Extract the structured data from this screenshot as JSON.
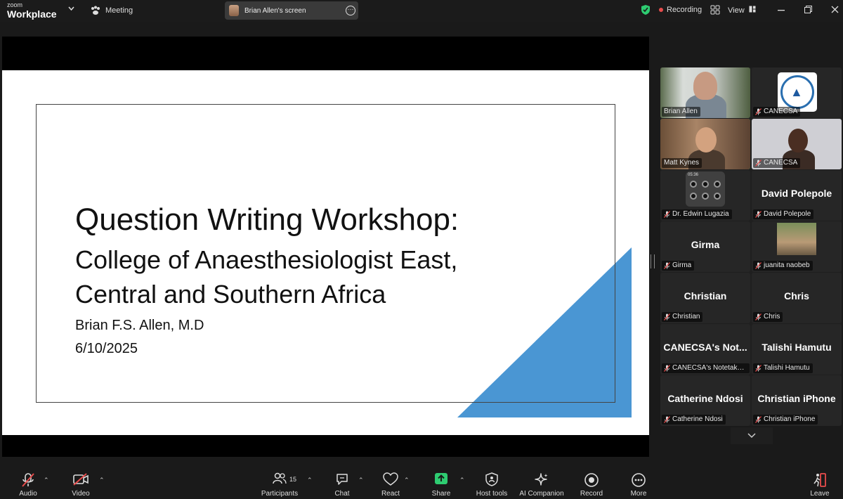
{
  "app": {
    "brand_small": "zoom",
    "brand_name": "Workplace"
  },
  "topbar": {
    "meeting_label": "Meeting",
    "screen_share_label": "Brian Allen's screen",
    "recording_label": "Recording",
    "view_label": "View"
  },
  "slide": {
    "title": "Question Writing Workshop:",
    "subtitle_line1": "College of Anaesthesiologist East,",
    "subtitle_line2": "Central and Southern Africa",
    "author": "Brian F.S. Allen, M.D",
    "date": "6/10/2025",
    "accent_color": "#4a96d3"
  },
  "participants": [
    {
      "label": "Brian Allen",
      "display": "",
      "muted": false,
      "type": "video"
    },
    {
      "label": "CANECSA",
      "display": "",
      "muted": true,
      "type": "logo"
    },
    {
      "label": "Matt Kynes",
      "display": "",
      "muted": false,
      "type": "video",
      "active_speaker": true
    },
    {
      "label": "CANECSA",
      "display": "",
      "muted": true,
      "type": "video"
    },
    {
      "label": "Dr. Edwin Lugazia",
      "display": "",
      "muted": true,
      "type": "phone",
      "phone_time": "05:36"
    },
    {
      "label": "David Polepole",
      "display": "David Polepole",
      "muted": true,
      "type": "name"
    },
    {
      "label": "Girma",
      "display": "Girma",
      "muted": true,
      "type": "name"
    },
    {
      "label": "juanita naobeb",
      "display": "",
      "muted": true,
      "type": "picture"
    },
    {
      "label": "Christian",
      "display": "Christian",
      "muted": true,
      "type": "name"
    },
    {
      "label": "Chris",
      "display": "Chris",
      "muted": true,
      "type": "name"
    },
    {
      "label": "CANECSA's Notetaker ...",
      "display": "CANECSA's  Not...",
      "muted": true,
      "type": "name"
    },
    {
      "label": "Talishi Hamutu",
      "display": "Talishi Hamutu",
      "muted": true,
      "type": "name"
    },
    {
      "label": "Catherine Ndosi",
      "display": "Catherine Ndosi",
      "muted": true,
      "type": "name"
    },
    {
      "label": "Christian iPhone",
      "display": "Christian iPhone",
      "muted": true,
      "type": "name"
    }
  ],
  "toolbar": {
    "audio": "Audio",
    "video": "Video",
    "participants": "Participants",
    "participant_count": "15",
    "chat": "Chat",
    "react": "React",
    "share": "Share",
    "host_tools": "Host tools",
    "ai_companion": "AI Companion",
    "record": "Record",
    "more": "More",
    "leave": "Leave",
    "share_color": "#2ecc71"
  }
}
